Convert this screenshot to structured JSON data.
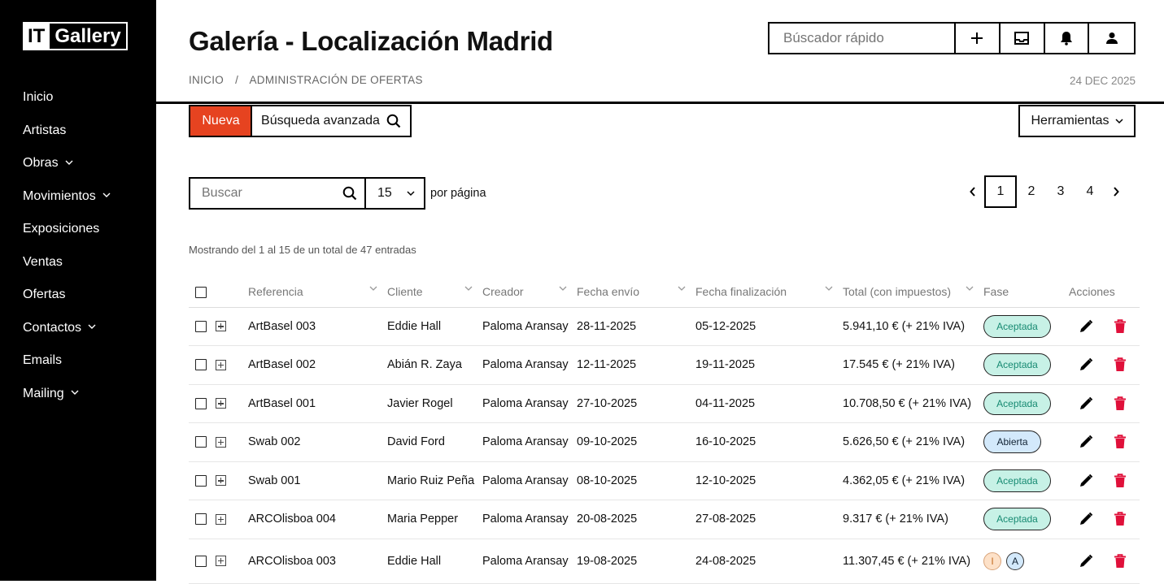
{
  "app": {
    "logo_it": "IT",
    "logo_name": "Gallery"
  },
  "sidebar": {
    "items": [
      {
        "label": "Inicio",
        "has_sub": false
      },
      {
        "label": "Artistas",
        "has_sub": false
      },
      {
        "label": "Obras",
        "has_sub": true
      },
      {
        "label": "Movimientos",
        "has_sub": true
      },
      {
        "label": "Exposiciones",
        "has_sub": false
      },
      {
        "label": "Ventas",
        "has_sub": false
      },
      {
        "label": "Ofertas",
        "has_sub": false
      },
      {
        "label": "Contactos",
        "has_sub": true
      },
      {
        "label": "Emails",
        "has_sub": false
      },
      {
        "label": "Mailing",
        "has_sub": true
      }
    ]
  },
  "header": {
    "title": "Galería - Localización Madrid",
    "breadcrumb": [
      "INICIO",
      "ADMINISTRACIÓN DE OFERTAS"
    ],
    "breadcrumb_sep": "/",
    "date": "24 DEC 2025",
    "quick_search_placeholder": "Búscador rápido"
  },
  "toolbar": {
    "new_label": "Nueva",
    "advanced_search_label": "Búsqueda avanzada",
    "tools_label": "Herramientas"
  },
  "filters": {
    "search_placeholder": "Buscar",
    "per_page_value": "15",
    "per_page_label": "por página"
  },
  "pagination": {
    "pages": [
      "1",
      "2",
      "3",
      "4"
    ],
    "current": "1"
  },
  "showing_text": "Mostrando del 1 al 15 de un total de 47 entradas",
  "table": {
    "columns": [
      "Referencia",
      "Cliente",
      "Creador",
      "Fecha envío",
      "Fecha finalización",
      "Total (con impuestos)",
      "Fase",
      "Acciones"
    ],
    "rows": [
      {
        "ref": "ArtBasel 003",
        "client": "Eddie Hall",
        "creator": "Paloma Aransay",
        "sent": "28-11-2025",
        "end": "05-12-2025",
        "total": "5.941,10 € (+ 21% IVA)",
        "phase": "Aceptada",
        "phase_type": "ok"
      },
      {
        "ref": "ArtBasel 002",
        "client": "Abián R. Zaya",
        "creator": "Paloma Aransay",
        "sent": "12-11-2025",
        "end": "19-11-2025",
        "total": "17.545 € (+ 21% IVA)",
        "phase": "Aceptada",
        "phase_type": "ok"
      },
      {
        "ref": "ArtBasel 001",
        "client": "Javier Rogel",
        "creator": "Paloma Aransay",
        "sent": "27-10-2025",
        "end": "04-11-2025",
        "total": "10.708,50 € (+ 21% IVA)",
        "phase": "Aceptada",
        "phase_type": "ok"
      },
      {
        "ref": "Swab 002",
        "client": "David Ford",
        "creator": "Paloma Aransay",
        "sent": "09-10-2025",
        "end": "16-10-2025",
        "total": "5.626,50 € (+ 21% IVA)",
        "phase": "Abierta",
        "phase_type": "open"
      },
      {
        "ref": "Swab 001",
        "client": "Mario Ruiz Peña",
        "creator": "Paloma Aransay",
        "sent": "08-10-2025",
        "end": "12-10-2025",
        "total": "4.362,05 € (+ 21% IVA)",
        "phase": "Aceptada",
        "phase_type": "ok"
      },
      {
        "ref": "ARCOlisboa 004",
        "client": "Maria Pepper",
        "creator": "Paloma Aransay",
        "sent": "20-08-2025",
        "end": "27-08-2025",
        "total": "9.317 € (+ 21% IVA)",
        "phase": "Aceptada",
        "phase_type": "ok"
      },
      {
        "ref": "ARCOlisboa 003",
        "client": "Eddie Hall",
        "creator": "Paloma Aransay",
        "sent": "19-08-2025",
        "end": "24-08-2025",
        "total": "11.307,45 € (+ 21% IVA)",
        "phase": "",
        "phase_type": "mini",
        "mini": [
          "I",
          "A"
        ]
      }
    ]
  },
  "colors": {
    "accent": "#e64320",
    "accepted_bg": "#c7f1e6",
    "open_bg": "#d3e9fb",
    "delete": "#e0103a"
  }
}
